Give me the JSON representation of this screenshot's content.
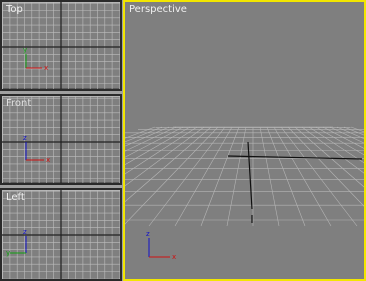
{
  "viewports": {
    "top": {
      "label": "Top",
      "axes": {
        "u": "x",
        "v": "y"
      }
    },
    "front": {
      "label": "Front",
      "axes": {
        "u": "x",
        "v": "z"
      }
    },
    "left": {
      "label": "Left",
      "axes": {
        "u": "y",
        "v": "z"
      }
    },
    "perspective": {
      "label": "Perspective",
      "axes": {
        "u": "x",
        "v": "z"
      }
    }
  },
  "colors": {
    "viewport_bg": "#7f7f7f",
    "grid": "#bdbdbd",
    "grid_main": "#202020",
    "active_border": "#f2e600",
    "axis_x": "#d01010",
    "axis_y": "#10a010",
    "axis_z": "#1010c8"
  }
}
